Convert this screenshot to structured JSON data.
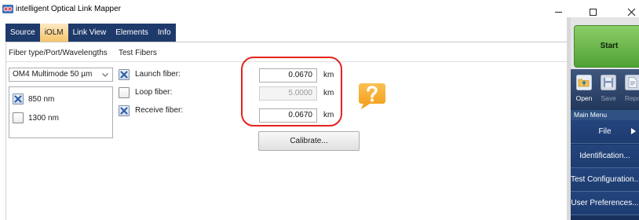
{
  "window": {
    "title": "intelligent Optical Link Mapper",
    "app_icon": "app-logo-icon",
    "controls": [
      "minimize-icon",
      "maximize-icon",
      "close-icon"
    ]
  },
  "tabs": [
    {
      "label": "Source",
      "selected": false
    },
    {
      "label": "iOLM",
      "selected": true
    },
    {
      "label": "Link View",
      "selected": false
    },
    {
      "label": "Elements",
      "selected": false
    },
    {
      "label": "Info",
      "selected": false
    }
  ],
  "fiber_panel": {
    "header": "Fiber type/Port/Wavelengths",
    "fiber_type": {
      "selected": "OM4 Multimode 50 µm",
      "icon": "chevron-down-icon"
    },
    "wavelengths": [
      {
        "label": "850 nm",
        "checked": true
      },
      {
        "label": "1300 nm",
        "checked": false
      }
    ]
  },
  "test_fibers": {
    "header": "Test Fibers",
    "fibers": [
      {
        "label": "Launch fiber:",
        "checked": true,
        "value": "0.0670",
        "unit": "km",
        "enabled": true
      },
      {
        "label": "Loop fiber:",
        "checked": false,
        "value": "5.0000",
        "unit": "km",
        "enabled": false
      },
      {
        "label": "Receive fiber:",
        "checked": true,
        "value": "0.0670",
        "unit": "km",
        "enabled": true
      }
    ],
    "calibrate_label": "Calibrate...",
    "help_icon": "help-bubble-icon"
  },
  "side_panel": {
    "start_label": "Start",
    "toolbar": [
      {
        "label": "Open",
        "icon": "open-folder-icon",
        "enabled": true
      },
      {
        "label": "Save",
        "icon": "save-icon",
        "enabled": false
      },
      {
        "label": "Repo",
        "icon": "report-icon",
        "enabled": false
      }
    ],
    "main_menu": {
      "header": "Main Menu",
      "items": [
        {
          "label": "File",
          "icon": "chevron-right-icon"
        },
        {
          "label": "Identification..."
        },
        {
          "label": "Test Configuration..."
        },
        {
          "label": "User Preferences..."
        }
      ]
    }
  },
  "colors": {
    "tab_bar": "#1e3a6b",
    "selected_tab": "#f6c46a",
    "start_button": "#4fa236",
    "menu_item": "#1d3c71",
    "annotation": "#e3231e",
    "help_bubble": "#f5a21c",
    "checkbox_mark": "#2f5fa8"
  }
}
